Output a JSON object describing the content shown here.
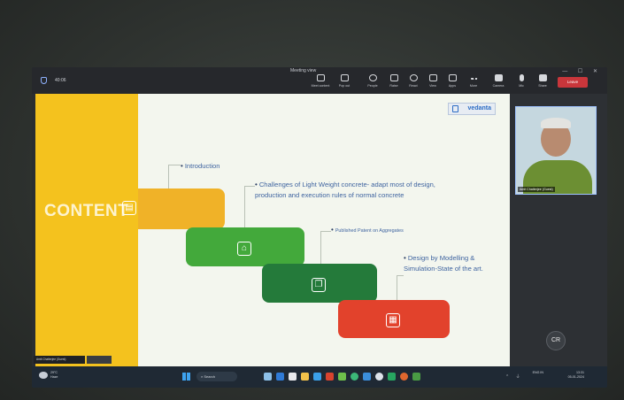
{
  "window": {
    "title": "Meeting view",
    "controls": "—  ☐  ✕",
    "timer": "40:06"
  },
  "toolbar": [
    {
      "label": "Meet content",
      "icon": "monitor-icon"
    },
    {
      "label": "Pop out",
      "icon": "popout-icon"
    },
    {
      "label": "People",
      "icon": "people-icon"
    },
    {
      "label": "Raise",
      "icon": "hand-icon"
    },
    {
      "label": "React",
      "icon": "react-icon"
    },
    {
      "label": "View",
      "icon": "view-icon"
    },
    {
      "label": "Apps",
      "icon": "apps-icon"
    },
    {
      "label": "More",
      "icon": "more-icon"
    },
    {
      "label": "Camera",
      "icon": "camera-icon"
    },
    {
      "label": "Mic",
      "icon": "mic-icon"
    },
    {
      "label": "Share",
      "icon": "share-icon"
    }
  ],
  "leave_label": "Leave",
  "slide": {
    "logo": "vedanta",
    "heading": "CONTENT",
    "bullets": [
      "Introduction",
      "Challenges of Light Weight concrete- adapt most of design, production and execution rules of normal concrete",
      "Published Patent on Aggregates",
      "Design by Modelling & Simulation-State of the art."
    ],
    "colors": {
      "yellow": "#f4c21e",
      "orange": "#f0b228",
      "green": "#43a93b",
      "dark_green": "#247a3a",
      "red": "#e2422c"
    }
  },
  "side": {
    "video_name": "Amit Chatterjee (Guest)",
    "avatar_initials": "CR"
  },
  "name_tag": "Amit Chatterjee (Guest)",
  "taskbar": {
    "weather_temp": "29°C",
    "weather_desc": "Haze",
    "search_label": "Search",
    "lang": "ENG\nIN",
    "time": "13:31",
    "date": "05-01-2024"
  }
}
